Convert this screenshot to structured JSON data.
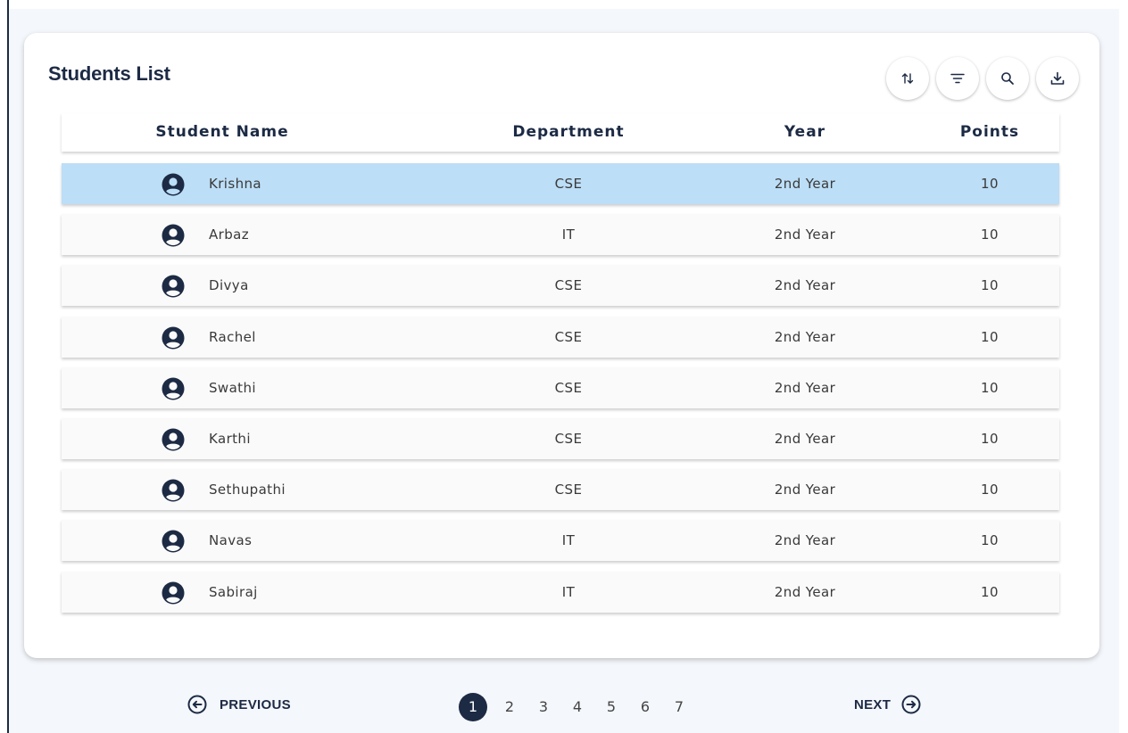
{
  "card": {
    "title": "Students List",
    "toolbar": [
      {
        "name": "sort-button",
        "icon": "sort-arrows-icon"
      },
      {
        "name": "filter-button",
        "icon": "filter-icon"
      },
      {
        "name": "search-button",
        "icon": "search-icon"
      },
      {
        "name": "download-button",
        "icon": "download-icon"
      }
    ]
  },
  "table": {
    "headers": {
      "name": "Student Name",
      "department": "Department",
      "year": "Year",
      "points": "Points"
    },
    "rows": [
      {
        "name": "Krishna",
        "department": "CSE",
        "year": "2nd Year",
        "points": "10"
      },
      {
        "name": "Arbaz",
        "department": "IT",
        "year": "2nd Year",
        "points": "10"
      },
      {
        "name": "Divya",
        "department": "CSE",
        "year": "2nd Year",
        "points": "10"
      },
      {
        "name": "Rachel",
        "department": "CSE",
        "year": "2nd Year",
        "points": "10"
      },
      {
        "name": "Swathi",
        "department": "CSE",
        "year": "2nd Year",
        "points": "10"
      },
      {
        "name": "Karthi",
        "department": "CSE",
        "year": "2nd Year",
        "points": "10"
      },
      {
        "name": "Sethupathi",
        "department": "CSE",
        "year": "2nd Year",
        "points": "10"
      },
      {
        "name": "Navas",
        "department": "IT",
        "year": "2nd Year",
        "points": "10"
      },
      {
        "name": "Sabiraj",
        "department": "IT",
        "year": "2nd Year",
        "points": "10"
      }
    ],
    "selected_row": 0
  },
  "pagination": {
    "previous_label": "PREVIOUS",
    "next_label": "NEXT",
    "pages": [
      "1",
      "2",
      "3",
      "4",
      "5",
      "6",
      "7"
    ],
    "current_page": "1"
  },
  "colors": {
    "primary": "#1c2a44",
    "selected_row": "#bcdef7",
    "row_bg": "#fafafa"
  }
}
